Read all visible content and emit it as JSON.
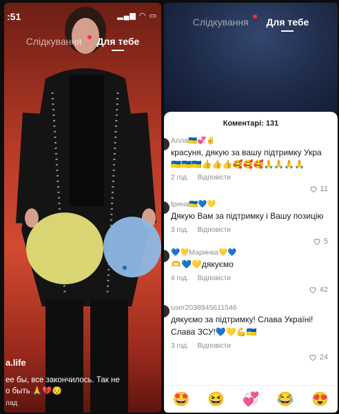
{
  "left": {
    "status_time": ":51",
    "tabs": {
      "following": "Слідкування",
      "for_you": "Для тебе"
    },
    "user_handle": "a.life",
    "caption": "ее бы, все закончилось. Так не",
    "caption_line2": "о быть 🙏💔😔",
    "translated": "лад"
  },
  "right": {
    "tabs": {
      "following": "Слідкування",
      "for_you": "Для тебе"
    },
    "comments_header": "Коментарі: 131",
    "comments": [
      {
        "user": "Алла🇺🇦💞✌️",
        "text": "красуня, дякую за вашу підтримку Укра",
        "emojis": "🇺🇦🇺🇦🇺🇦👍👍👍🥰🥰🥰🙏🙏🙏🙏",
        "age": "2 год.",
        "reply": "Відповісти",
        "likes": "11"
      },
      {
        "user": "Ірина🇺🇦💙💛",
        "text": "Дякую Вам за підтримку і Вашу позицію",
        "age": "3 год.",
        "reply": "Відповісти",
        "likes": "5"
      },
      {
        "user": "💙💛Маринка💛💙",
        "text": "🫶💙💛дякуємо",
        "age": "4 год.",
        "reply": "Відповісти",
        "likes": "42"
      },
      {
        "user": "user2038945611546",
        "text": "дякуємо за підтримку! Слава Україні!",
        "text2": "Слава ЗСУ!💙💛💪🇺🇦",
        "age": "3 год.",
        "reply": "Відповісти",
        "likes": "24"
      }
    ],
    "emoji_bar": [
      "🤩",
      "😆",
      "💞",
      "😂",
      "😍"
    ]
  }
}
